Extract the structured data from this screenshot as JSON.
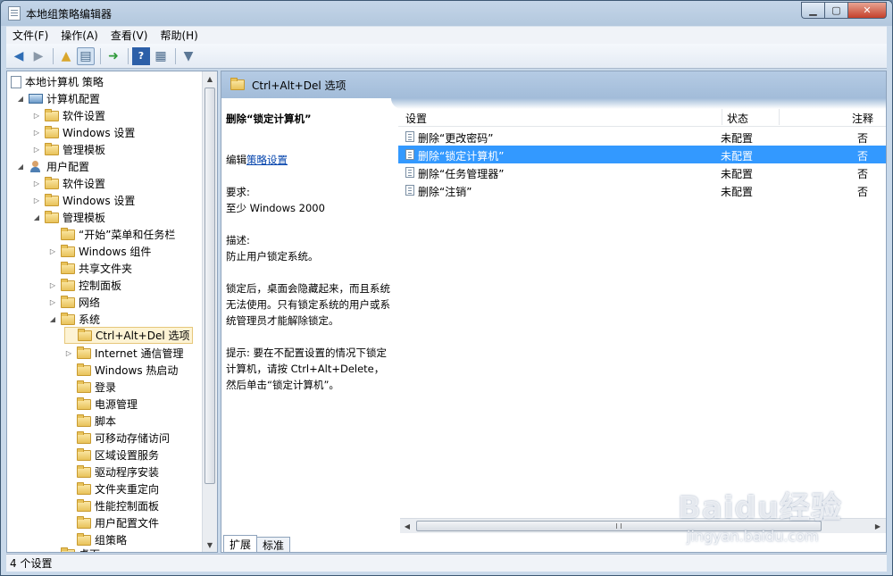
{
  "window": {
    "title": "本地组策略编辑器"
  },
  "menubar": [
    {
      "label": "文件(F)"
    },
    {
      "label": "操作(A)"
    },
    {
      "label": "查看(V)"
    },
    {
      "label": "帮助(H)"
    }
  ],
  "tree": {
    "root": "本地计算机 策略",
    "computer_config": "计算机配置",
    "cc_software": "软件设置",
    "cc_windows": "Windows 设置",
    "cc_admin": "管理模板",
    "user_config": "用户配置",
    "uc_software": "软件设置",
    "uc_windows": "Windows 设置",
    "uc_admin": "管理模板",
    "start_menu": "“开始”菜单和任务栏",
    "win_components": "Windows 组件",
    "shared_folders": "共享文件夹",
    "control_panel": "控制面板",
    "network": "网络",
    "system": "系统",
    "cad": "Ctrl+Alt+Del 选项",
    "internet_comm": "Internet 通信管理",
    "win_hotstart": "Windows 热启动",
    "logon": "登录",
    "power": "电源管理",
    "scripts": "脚本",
    "removable": "可移动存储访问",
    "locale": "区域设置服务",
    "driver": "驱动程序安装",
    "folder_redirect": "文件夹重定向",
    "perf": "性能控制面板",
    "user_profiles": "用户配置文件",
    "group_policy": "组策略",
    "desktop": "桌面"
  },
  "right": {
    "header_title": "Ctrl+Alt+Del 选项",
    "desc": {
      "title": "删除“锁定计算机”",
      "edit_prefix": "编辑",
      "edit_link": "策略设置",
      "req_label": "要求:",
      "req_value": "至少 Windows 2000",
      "desc_label": "描述:",
      "desc_value": "防止用户锁定系统。",
      "detail": "锁定后，桌面会隐藏起来，而且系统无法使用。只有锁定系统的用户或系统管理员才能解除锁定。",
      "tip": "提示: 要在不配置设置的情况下锁定计算机，请按 Ctrl+Alt+Delete，然后单击“锁定计算机”。"
    },
    "columns": {
      "setting": "设置",
      "state": "状态",
      "comment": "注释"
    },
    "rows": [
      {
        "setting": "删除“更改密码”",
        "state": "未配置",
        "comment": "否"
      },
      {
        "setting": "删除“锁定计算机”",
        "state": "未配置",
        "comment": "否"
      },
      {
        "setting": "删除“任务管理器”",
        "state": "未配置",
        "comment": "否"
      },
      {
        "setting": "删除“注销”",
        "state": "未配置",
        "comment": "否"
      }
    ],
    "tabs": {
      "extended": "扩展",
      "standard": "标准"
    }
  },
  "status": {
    "text": "4 个设置"
  },
  "watermark": {
    "main": "Baidu经验",
    "sub": "jingyan.baidu.com"
  },
  "colors": {
    "selection": "#3399ff",
    "header_band": "#a2bcd9"
  }
}
